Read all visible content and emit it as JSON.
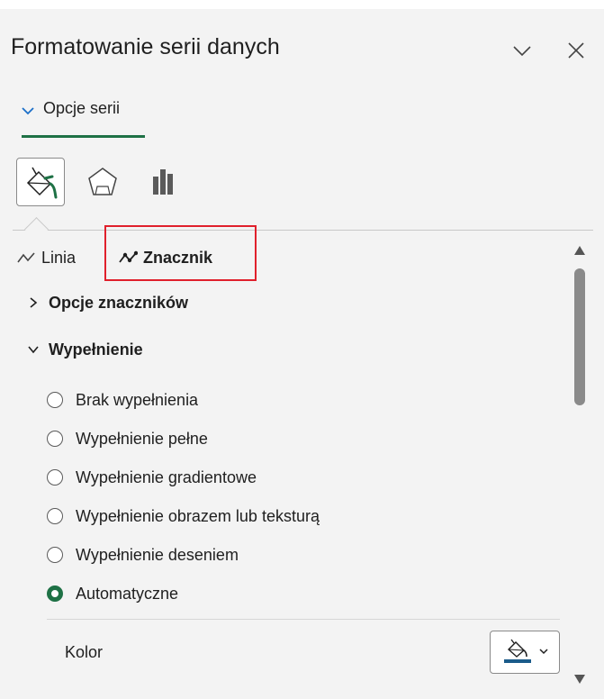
{
  "pane": {
    "title": "Formatowanie serii danych",
    "series_options": "Opcje serii"
  },
  "tabs": {
    "line": "Linia",
    "marker": "Znacznik"
  },
  "sections": {
    "marker_options": "Opcje znaczników",
    "fill": "Wypełnienie"
  },
  "fill_options": [
    {
      "label": "Brak wypełnienia",
      "checked": false
    },
    {
      "label": "Wypełnienie pełne",
      "checked": false
    },
    {
      "label": "Wypełnienie gradientowe",
      "checked": false
    },
    {
      "label": "Wypełnienie obrazem lub teksturą",
      "checked": false
    },
    {
      "label": "Wypełnienie deseniem",
      "checked": false
    },
    {
      "label": "Automatyczne",
      "checked": true
    }
  ],
  "color": {
    "label": "Kolor",
    "swatch": "#1b5b8a"
  },
  "accent": "#1e7145",
  "highlight": "#e0202c"
}
